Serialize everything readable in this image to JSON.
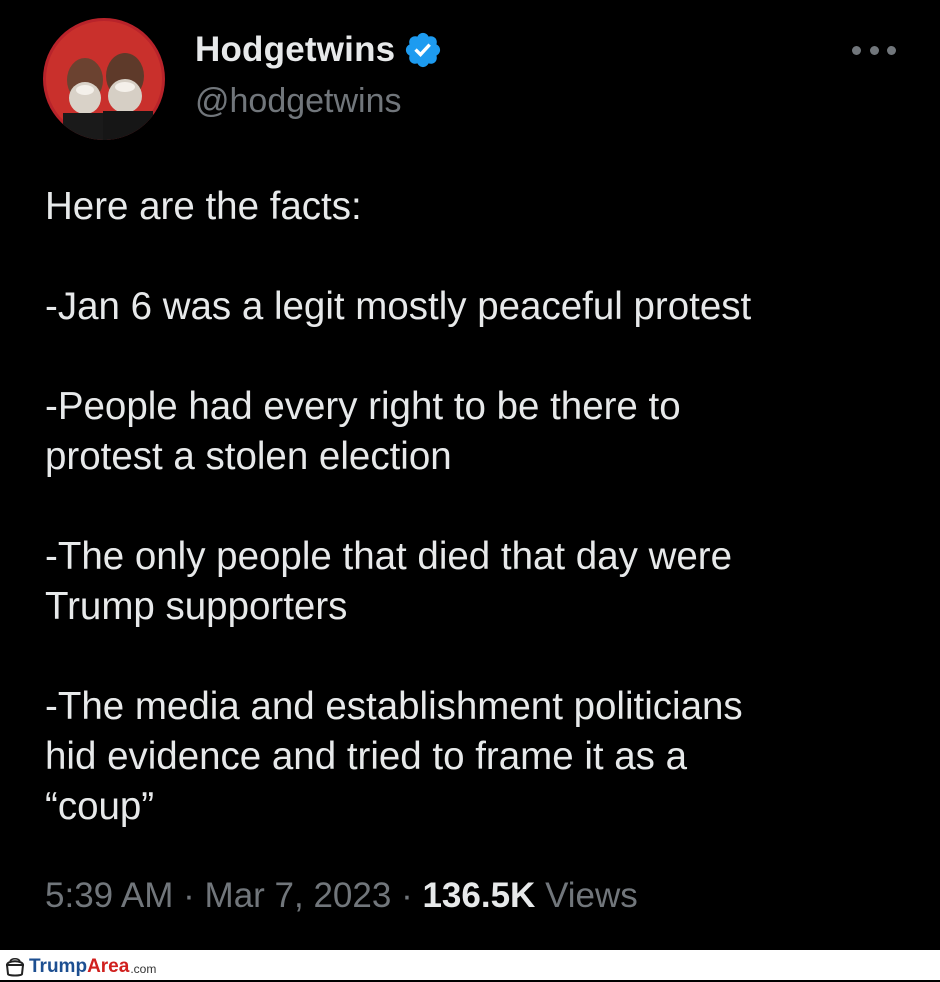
{
  "tweet": {
    "display_name": "Hodgetwins",
    "handle": "@hodgetwins",
    "paragraphs": [
      "Here are the facts:",
      "-Jan 6 was a legit mostly peaceful protest",
      "-People had every right to be there to\nprotest a stolen election",
      "-The only people that died that day were\nTrump supporters",
      "-The media and establishment politicians\nhid evidence and tried to frame it as a\n“coup”"
    ],
    "time": "5:39 AM",
    "separator": "·",
    "date": "Mar 7, 2023",
    "views_count": "136.5K",
    "views_label": "Views"
  },
  "watermark": {
    "part1": "Trump",
    "part2": "Area",
    "part3": ".com"
  },
  "icons": {
    "verified": "verified-badge-icon",
    "more": "more-options-icon",
    "watermark": "trumparea-logo-icon"
  },
  "colors": {
    "background": "#000000",
    "text": "#e7e9ea",
    "secondary": "#71767b",
    "verified_blue": "#1d9bf0"
  }
}
